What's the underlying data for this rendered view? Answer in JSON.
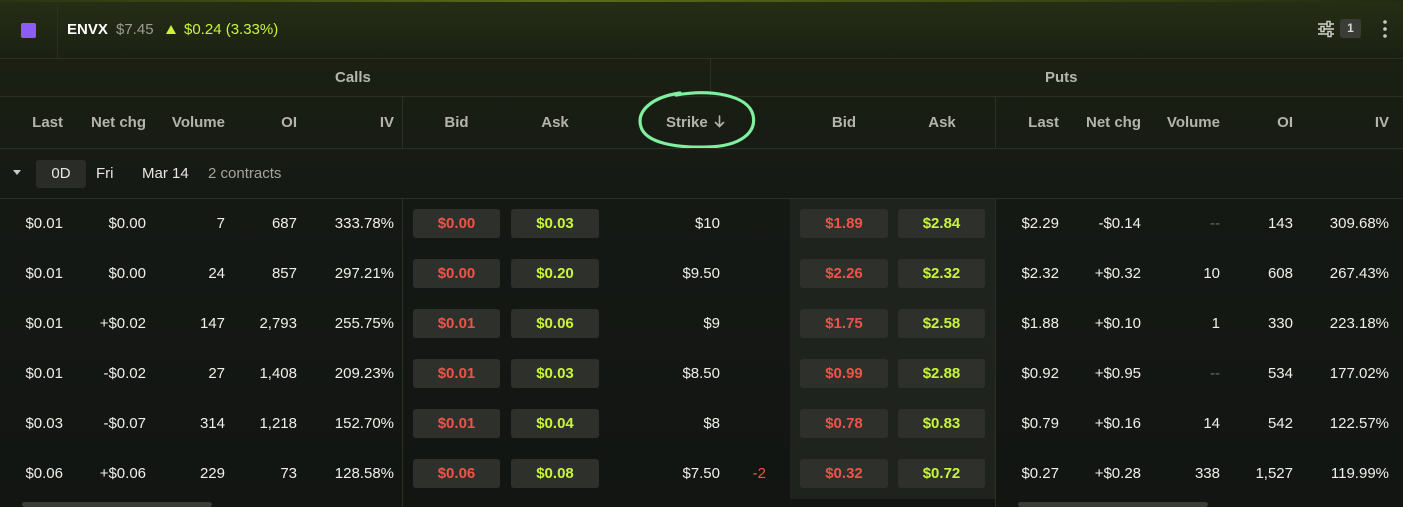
{
  "header": {
    "ticker": "ENVX",
    "price": "$7.45",
    "change": "$0.24 (3.33%)",
    "filter_count": "1",
    "colors": {
      "up": "#c8f53c",
      "down": "#f0524a",
      "swatch": "#8b5cf6",
      "annotation": "#7ff0a0"
    },
    "icons": [
      "settings-sliders-icon",
      "more-vertical-icon",
      "triangle-up-icon"
    ]
  },
  "groups": {
    "calls": "Calls",
    "puts": "Puts"
  },
  "columns": {
    "calls": [
      "Last",
      "Net chg",
      "Volume",
      "OI",
      "IV",
      "Bid",
      "Ask"
    ],
    "strike": "Strike",
    "puts": [
      "Bid",
      "Ask",
      "Last",
      "Net chg",
      "Volume",
      "OI",
      "IV"
    ]
  },
  "expiry": {
    "chip": "0D",
    "day": "Fri",
    "date": "Mar 14",
    "contracts": "2 contracts"
  },
  "rows": [
    {
      "calls": {
        "last": "$0.01",
        "net": "$0.00",
        "vol": "7",
        "oi": "687",
        "iv": "333.78%",
        "bid": "$0.00",
        "ask": "$0.03"
      },
      "strike": "$10",
      "position": "",
      "puts": {
        "bid": "$1.89",
        "ask": "$2.84",
        "last": "$2.29",
        "net": "-$0.14",
        "vol": "--",
        "oi": "143",
        "iv": "309.68%"
      }
    },
    {
      "calls": {
        "last": "$0.01",
        "net": "$0.00",
        "vol": "24",
        "oi": "857",
        "iv": "297.21%",
        "bid": "$0.00",
        "ask": "$0.20"
      },
      "strike": "$9.50",
      "position": "",
      "puts": {
        "bid": "$2.26",
        "ask": "$2.32",
        "last": "$2.32",
        "net": "+$0.32",
        "vol": "10",
        "oi": "608",
        "iv": "267.43%"
      }
    },
    {
      "calls": {
        "last": "$0.01",
        "net": "+$0.02",
        "vol": "147",
        "oi": "2,793",
        "iv": "255.75%",
        "bid": "$0.01",
        "ask": "$0.06"
      },
      "strike": "$9",
      "position": "",
      "puts": {
        "bid": "$1.75",
        "ask": "$2.58",
        "last": "$1.88",
        "net": "+$0.10",
        "vol": "1",
        "oi": "330",
        "iv": "223.18%"
      }
    },
    {
      "calls": {
        "last": "$0.01",
        "net": "-$0.02",
        "vol": "27",
        "oi": "1,408",
        "iv": "209.23%",
        "bid": "$0.01",
        "ask": "$0.03"
      },
      "strike": "$8.50",
      "position": "",
      "puts": {
        "bid": "$0.99",
        "ask": "$2.88",
        "last": "$0.92",
        "net": "+$0.95",
        "vol": "--",
        "oi": "534",
        "iv": "177.02%"
      }
    },
    {
      "calls": {
        "last": "$0.03",
        "net": "-$0.07",
        "vol": "314",
        "oi": "1,218",
        "iv": "152.70%",
        "bid": "$0.01",
        "ask": "$0.04"
      },
      "strike": "$8",
      "position": "",
      "puts": {
        "bid": "$0.78",
        "ask": "$0.83",
        "last": "$0.79",
        "net": "+$0.16",
        "vol": "14",
        "oi": "542",
        "iv": "122.57%"
      }
    },
    {
      "calls": {
        "last": "$0.06",
        "net": "+$0.06",
        "vol": "229",
        "oi": "73",
        "iv": "128.58%",
        "bid": "$0.06",
        "ask": "$0.08"
      },
      "strike": "$7.50",
      "position": "-2",
      "puts": {
        "bid": "$0.32",
        "ask": "$0.72",
        "last": "$0.27",
        "net": "+$0.28",
        "vol": "338",
        "oi": "1,527",
        "iv": "119.99%"
      }
    }
  ]
}
